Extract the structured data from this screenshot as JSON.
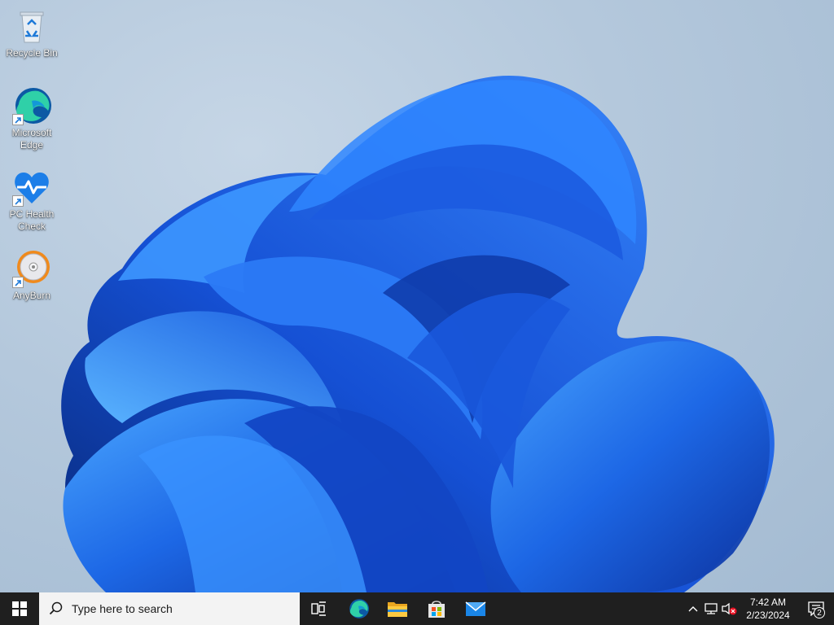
{
  "desktop": {
    "icons": [
      {
        "label": "Recycle Bin",
        "icon": "recycle-bin-icon"
      },
      {
        "label": "Microsoft\nEdge",
        "icon": "edge-icon"
      },
      {
        "label": "PC Health\nCheck",
        "icon": "pc-health-check-icon"
      },
      {
        "label": "AnyBurn",
        "icon": "anyburn-icon"
      }
    ]
  },
  "taskbar": {
    "search_placeholder": "Type here to search",
    "pinned": [
      "task-view-icon",
      "edge-icon",
      "file-explorer-icon",
      "microsoft-store-icon",
      "mail-icon"
    ],
    "tray": {
      "time": "7:42 AM",
      "date": "2/23/2024",
      "notification_count": "2"
    }
  },
  "colors": {
    "taskbar": "#1f1f1f",
    "search_box": "#f3f3f3",
    "bloom": "#1a5fe0",
    "accent": "#0078d4"
  }
}
